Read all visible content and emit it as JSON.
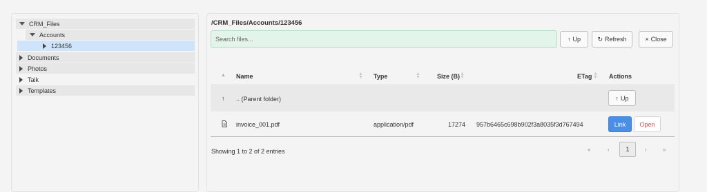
{
  "tree": {
    "root": "CRM_Files",
    "accounts": "Accounts",
    "selected": "123456",
    "documents": "Documents",
    "photos": "Photos",
    "talk": "Talk",
    "templates": "Templates"
  },
  "browser": {
    "path": "/CRM_Files/Accounts/123456",
    "search_placeholder": "Search files...",
    "up_label": "Up",
    "refresh_label": "Refresh",
    "close_label": "Close",
    "up_icon": "↑",
    "refresh_icon": "↻",
    "close_icon": "×"
  },
  "table": {
    "columns": {
      "name": "Name",
      "type": "Type",
      "size": "Size (B)",
      "etag": "ETag",
      "actions": "Actions"
    },
    "parent_row": {
      "icon": "↑",
      "name": ".. (Parent folder)",
      "action": "Up"
    },
    "file_row": {
      "name": "invoice_001.pdf",
      "type": "application/pdf",
      "size": "17274",
      "etag": "957b6465c698b902f3a8035f3d767494",
      "link_label": "Link",
      "open_label": "Open"
    }
  },
  "footer": {
    "info": "Showing 1 to 2 of 2 entries",
    "first": "«",
    "prev": "‹",
    "page": "1",
    "next": "›",
    "last": "»"
  }
}
